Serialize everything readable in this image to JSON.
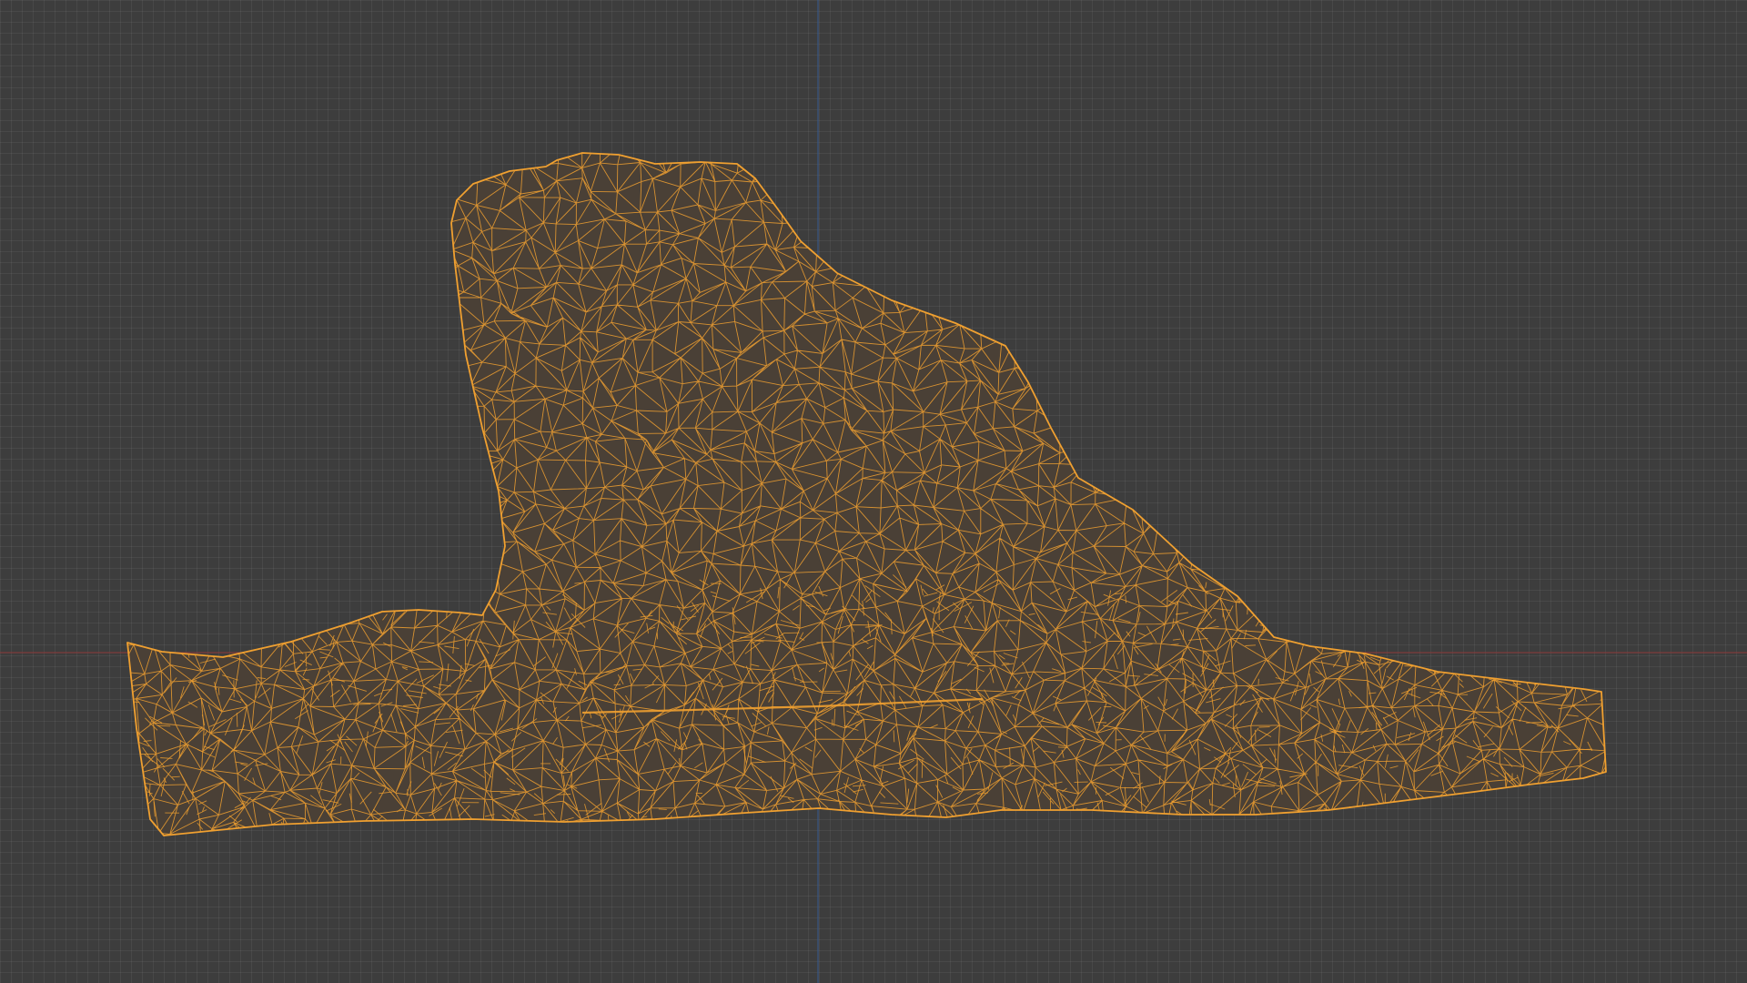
{
  "app": {
    "title": ""
  },
  "viewport": {
    "mode": "wireframe",
    "background_color": "#3d3d3d",
    "grid_color": "#464646",
    "wire_color": "#f0a030",
    "x_axis_color": "#8a3a3a",
    "y_axis_color": "#3a5a8a",
    "object_icon": "mesh-icon"
  }
}
